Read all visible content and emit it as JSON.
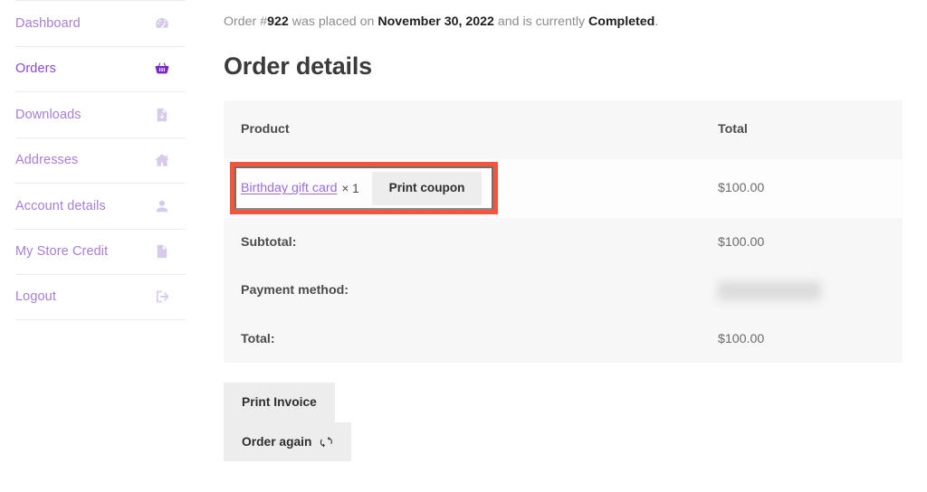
{
  "sidebar": {
    "items": [
      {
        "label": "Dashboard",
        "icon": "dashboard-gauge-icon",
        "active": false
      },
      {
        "label": "Orders",
        "icon": "shopping-basket-icon",
        "active": true
      },
      {
        "label": "Downloads",
        "icon": "download-file-icon",
        "active": false
      },
      {
        "label": "Addresses",
        "icon": "home-icon",
        "active": false
      },
      {
        "label": "Account details",
        "icon": "user-icon",
        "active": false
      },
      {
        "label": "My Store Credit",
        "icon": "document-icon",
        "active": false
      },
      {
        "label": "Logout",
        "icon": "logout-icon",
        "active": false
      }
    ]
  },
  "main": {
    "order_info": {
      "prefix": "Order #",
      "order_number": "922",
      "middle": " was placed on ",
      "date": "November 30, 2022",
      "connector": " and is currently ",
      "status": "Completed",
      "suffix": "."
    },
    "page_title": "Order details",
    "table": {
      "headers": {
        "product": "Product",
        "total": "Total"
      },
      "product_row": {
        "product_name": "Birthday gift card",
        "quantity": "× 1",
        "coupon_button": "Print coupon",
        "total": "$100.00"
      },
      "footer_rows": [
        {
          "label": "Subtotal:",
          "value": "$100.00",
          "redacted": false
        },
        {
          "label": "Payment method:",
          "value": "",
          "redacted": true
        },
        {
          "label": "Total:",
          "value": "$100.00",
          "redacted": false
        }
      ]
    },
    "actions": {
      "print_invoice": "Print Invoice",
      "order_again": "Order again",
      "order_again_icon": "sync-refresh-icon"
    }
  },
  "annotation": {
    "highlight_color": "#f4553d",
    "target": "product-name-and-print-coupon"
  },
  "colors": {
    "nav_link": "#a77fd4",
    "nav_link_active": "#8c4ad0",
    "nav_icon": "#d7cbe9",
    "nav_icon_active": "#7b26cc",
    "product_link": "#9b6cd6",
    "table_header_bg": "#f7f7f8",
    "button_bg": "#ededed",
    "highlight": "#f4553d"
  }
}
